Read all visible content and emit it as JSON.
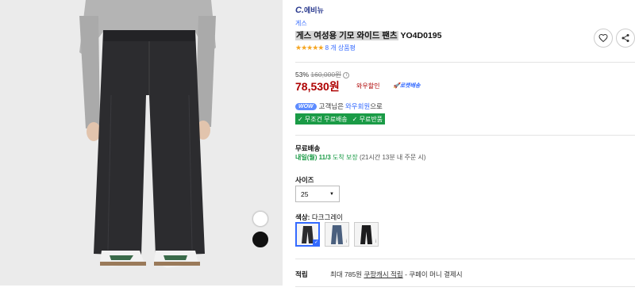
{
  "header": {
    "logo_mark": "C.",
    "logo_text": "에비뉴"
  },
  "product": {
    "store": "게스",
    "title_highlight": "게스 여성용 기모 와이드 팬츠",
    "title_code": "YO4D0195",
    "stars": "★★★★★",
    "review_count": "8 개 상품평"
  },
  "pricing": {
    "discount_rate": "53%",
    "original_price": "160,000원",
    "info_icon": "ⓘ",
    "sale_price": "78,530원",
    "price_tag": "와우할인",
    "rocket_label": "로켓배송"
  },
  "membership": {
    "badge": "WOW",
    "text_prefix": "고객님은",
    "member_label": "와우회원",
    "text_suffix": "으로"
  },
  "free_tags": [
    "✓ 무조건 무료배송",
    "✓ 무료반품"
  ],
  "shipping": {
    "label": "무료배송",
    "arrival_day": "내일(월)",
    "arrival_date": "11/3",
    "arrival_note": "도착 보장",
    "deadline": "(21시간 13분 내 주문 시)"
  },
  "size": {
    "label": "사이즈",
    "selected": "25",
    "caret": "▼"
  },
  "color": {
    "label": "색상:",
    "selected": "다크그레이",
    "check": "✓",
    "info": "i"
  },
  "earn": {
    "label": "적립",
    "text": "최대 785원",
    "link": "쿠팡캐시 적립",
    "suffix": "- 쿠페이 머니 결제시"
  },
  "icons": [
    "heart-icon",
    "share-icon",
    "star-icon",
    "info-icon",
    "check-icon",
    "caret-down-icon"
  ],
  "colors": {
    "accent": "#346aff",
    "price": "#ae0000",
    "green": "#1a9b46",
    "star": "#f5a623"
  }
}
